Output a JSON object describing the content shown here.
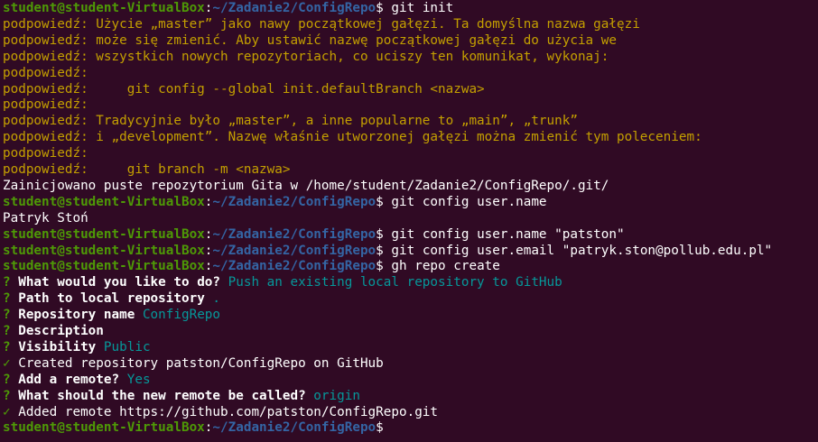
{
  "prompt": {
    "user": "student@student-VirtualBox",
    "sep": ":",
    "path": "~/Zadanie2/ConfigRepo",
    "symbol": "$ "
  },
  "colors": {
    "background": "#300a24",
    "user": "#4e9a06",
    "path": "#3465a4",
    "hint": "#c4a000",
    "answer": "#06989a"
  },
  "lines": [
    {
      "type": "prompt",
      "cmd": "git init"
    },
    {
      "type": "hint",
      "text": "podpowiedź: Użycie „master” jako nawy początkowej gałęzi. Ta domyślna nazwa gałęzi"
    },
    {
      "type": "hint",
      "text": "podpowiedź: może się zmienić. Aby ustawić nazwę początkowej gałęzi do użycia we"
    },
    {
      "type": "hint",
      "text": "podpowiedź: wszystkich nowych repozytoriach, co uciszy ten komunikat, wykonaj:"
    },
    {
      "type": "hint",
      "text": "podpowiedź:"
    },
    {
      "type": "hint",
      "text": "podpowiedź:     git config --global init.defaultBranch <nazwa>"
    },
    {
      "type": "hint",
      "text": "podpowiedź:"
    },
    {
      "type": "hint",
      "text": "podpowiedź: Tradycyjnie było „master”, a inne popularne to „main”, „trunk”"
    },
    {
      "type": "hint",
      "text": "podpowiedź: i „development”. Nazwę właśnie utworzonej gałęzi można zmienić tym poleceniem:"
    },
    {
      "type": "hint",
      "text": "podpowiedź:"
    },
    {
      "type": "hint",
      "text": "podpowiedź:     git branch -m <nazwa>"
    },
    {
      "type": "out",
      "text": "Zainicjowano puste repozytorium Gita w /home/student/Zadanie2/ConfigRepo/.git/"
    },
    {
      "type": "prompt",
      "cmd": "git config user.name"
    },
    {
      "type": "out",
      "text": "Patryk Stoń"
    },
    {
      "type": "prompt",
      "cmd": "git config user.name \"patston\""
    },
    {
      "type": "prompt",
      "cmd": "git config user.email \"patryk.ston@pollub.edu.pl\""
    },
    {
      "type": "prompt",
      "cmd": "gh repo create"
    },
    {
      "type": "q",
      "mark": "? ",
      "label": "What would you like to do?",
      "answer": " Push an existing local repository to GitHub"
    },
    {
      "type": "q",
      "mark": "? ",
      "label": "Path to local repository",
      "answer": " ."
    },
    {
      "type": "q",
      "mark": "? ",
      "label": "Repository name",
      "answer": " ConfigRepo"
    },
    {
      "type": "q",
      "mark": "? ",
      "label": "Description",
      "answer": ""
    },
    {
      "type": "q",
      "mark": "? ",
      "label": "Visibility",
      "answer": " Public"
    },
    {
      "type": "ok",
      "mark": "✓",
      "text": " Created repository patston/ConfigRepo on GitHub"
    },
    {
      "type": "q",
      "mark": "? ",
      "label": "Add a remote?",
      "answer": " Yes"
    },
    {
      "type": "q",
      "mark": "? ",
      "label": "What should the new remote be called?",
      "answer": " origin"
    },
    {
      "type": "ok",
      "mark": "✓",
      "text": " Added remote https://github.com/patston/ConfigRepo.git"
    },
    {
      "type": "prompt",
      "cmd": ""
    }
  ]
}
